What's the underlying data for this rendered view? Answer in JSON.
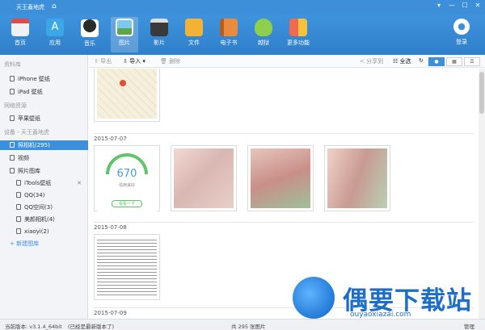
{
  "titlebar": {
    "title": "天王蓋地虎",
    "controls": [
      "▾",
      "—",
      "☐",
      "✕"
    ]
  },
  "toolbar": {
    "items": [
      {
        "label": "首页",
        "icon": "store-icon",
        "color": "#e9eef3"
      },
      {
        "label": "应用",
        "icon": "app-store-icon",
        "color": "#3aa8e8"
      },
      {
        "label": "音乐",
        "icon": "music-disc-icon",
        "color": "#2b2b2b"
      },
      {
        "label": "图片",
        "icon": "photo-icon",
        "color": "#4fb0e6"
      },
      {
        "label": "影片",
        "icon": "clapperboard-icon",
        "color": "#3a3a3a"
      },
      {
        "label": "文件",
        "icon": "folder-icon",
        "color": "#f2b233"
      },
      {
        "label": "电子书",
        "icon": "book-icon",
        "color": "#e98a3c"
      },
      {
        "label": "越狱",
        "icon": "pineapple-icon",
        "color": "#8fcf4c"
      },
      {
        "label": "更多功能",
        "icon": "more-icon",
        "color": "#f06a4f"
      }
    ],
    "active_index": 3,
    "login_label": "登录"
  },
  "sidebar": {
    "section_library": "资料库",
    "iphone_wallpaper": "iPhone 壁纸",
    "ipad_wallpaper": "iPad 壁纸",
    "section_network": "网络资源",
    "apple_wallpaper": "苹果壁纸",
    "section_device": "设备 - 天王蓋地虎",
    "camera_roll": "照相机(295)",
    "video": "视频",
    "photo_library": "照片图库",
    "albums": [
      "iTools壁纸",
      "QQ(34)",
      "QQ空间(3)",
      "美颜相机(4)",
      "xiaoyi(2)"
    ],
    "new_album": "+ 新建图库"
  },
  "actionbar": {
    "export": "导出",
    "import": "导入",
    "delete": "删除",
    "share": "分享到",
    "select_all": "全选"
  },
  "content": {
    "dates": [
      "2015-07-07",
      "2015-07-08",
      "2015-07-09"
    ],
    "score_card": {
      "score": "670",
      "rating": "信用良好",
      "button": "看看一下"
    }
  },
  "statusbar": {
    "version": "当前版本: v3.1.4_64bit",
    "update_note": "(已经是最新版本了)",
    "count": "共 295 张图片",
    "manage": "管理"
  },
  "watermark": {
    "name": "偶要下载站",
    "url": "ouyaoxiazai.com"
  }
}
